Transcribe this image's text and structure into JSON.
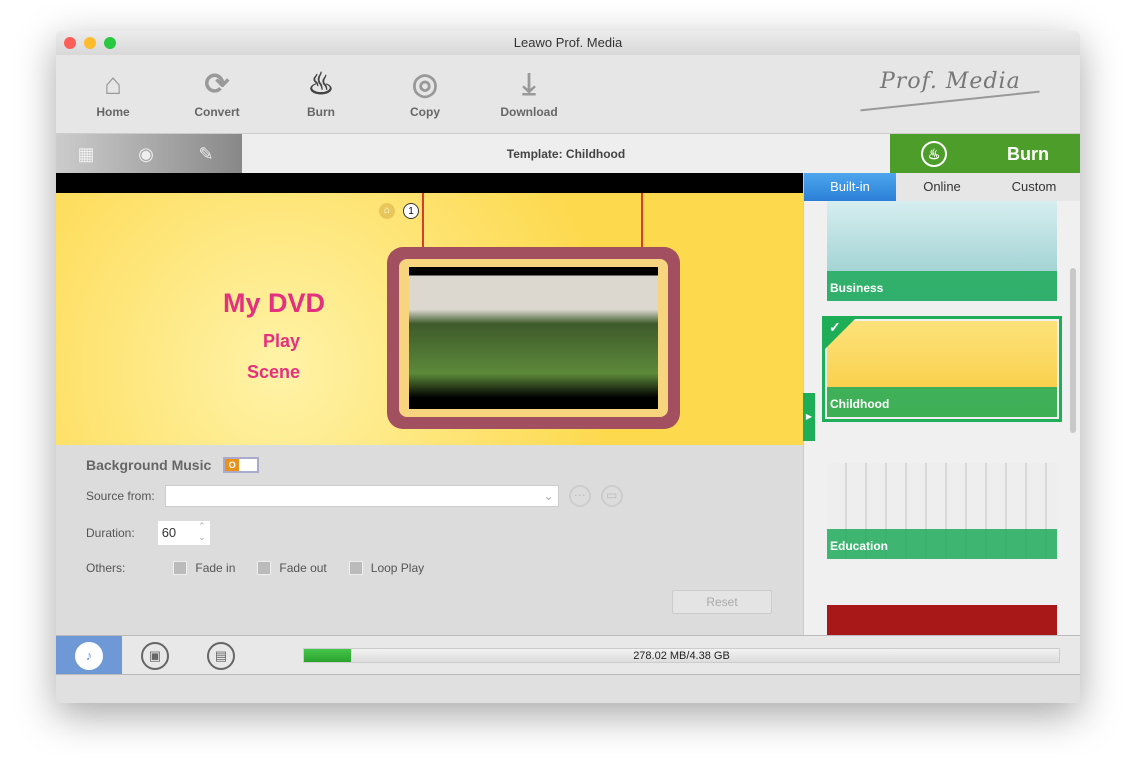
{
  "window": {
    "title": "Leawo Prof. Media"
  },
  "toolbar": {
    "items": [
      {
        "label": "Home",
        "icon": "home-icon"
      },
      {
        "label": "Convert",
        "icon": "convert-icon"
      },
      {
        "label": "Burn",
        "icon": "flame-icon"
      },
      {
        "label": "Copy",
        "icon": "disc-icon"
      },
      {
        "label": "Download",
        "icon": "download-icon"
      }
    ],
    "logo": "Prof. Media"
  },
  "subbar": {
    "template": "Template: Childhood",
    "burn_label": "Burn"
  },
  "preview": {
    "title": "My DVD",
    "play": "Play",
    "scene": "Scene",
    "page": "1"
  },
  "music": {
    "heading": "Background Music",
    "toggle": "O",
    "source_label": "Source from:",
    "source_value": "",
    "duration_label": "Duration:",
    "duration_value": "60",
    "others_label": "Others:",
    "fade_in": "Fade in",
    "fade_out": "Fade out",
    "loop": "Loop Play",
    "reset": "Reset"
  },
  "templates": {
    "tabs": [
      "Built-in",
      "Online",
      "Custom"
    ],
    "items": [
      {
        "name": "Business"
      },
      {
        "name": "Childhood",
        "selected": true
      },
      {
        "name": "Education"
      }
    ]
  },
  "bottom": {
    "usage": "278.02 MB/4.38 GB",
    "progress_percent": 6.2
  },
  "colors": {
    "accent_green": "#4d9d2a",
    "tab_blue": "#2a7fd6",
    "title_pink": "#e3307f"
  }
}
